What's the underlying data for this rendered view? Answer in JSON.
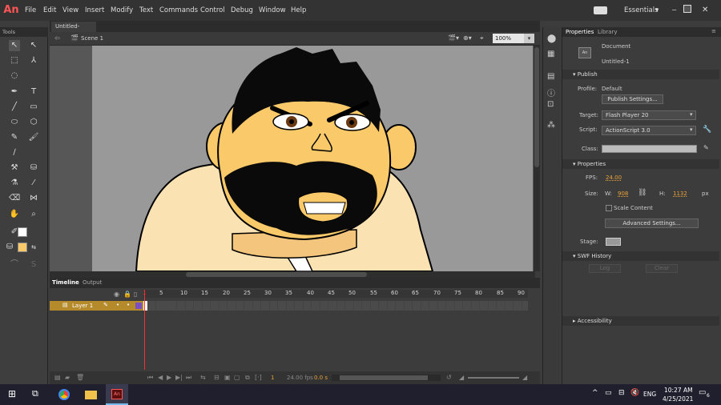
{
  "app": {
    "logo": "An",
    "workspace": "Essentials"
  },
  "menu": [
    "File",
    "Edit",
    "View",
    "Insert",
    "Modify",
    "Text",
    "Commands",
    "Control",
    "Debug",
    "Window",
    "Help"
  ],
  "tools_panel": {
    "title": "Tools"
  },
  "document": {
    "tab": "Untitled-1*",
    "scene": "Scene 1",
    "zoom": "100%"
  },
  "timeline": {
    "tabs": [
      "Timeline",
      "Output"
    ],
    "layer": "Layer 1",
    "frame_numbers": [
      "1",
      "5",
      "10",
      "15",
      "20",
      "25",
      "30",
      "35",
      "40",
      "45",
      "50",
      "55",
      "60",
      "65",
      "70",
      "75",
      "80",
      "85",
      "90"
    ],
    "current_frame": "1",
    "fps": "24.00 fps",
    "time": "0.0 s"
  },
  "properties": {
    "tabs": [
      "Properties",
      "Library"
    ],
    "doc_type": "Document",
    "doc_name": "Untitled-1",
    "publish": {
      "header": "Publish",
      "profile_label": "Profile:",
      "profile": "Default",
      "settings_btn": "Publish Settings...",
      "target_label": "Target:",
      "target": "Flash Player 20",
      "script_label": "Script:",
      "script": "ActionScript 3.0",
      "class_label": "Class:"
    },
    "props": {
      "header": "Properties",
      "fps_label": "FPS:",
      "fps": "24.00",
      "size_label": "Size:",
      "w_label": "W:",
      "w": "908",
      "h_label": "H:",
      "h": "1132",
      "unit": "px",
      "scale_label": "Scale Content",
      "advanced_btn": "Advanced Settings...",
      "stage_label": "Stage:",
      "stage_color": "#999999"
    },
    "swf": {
      "header": "SWF History",
      "log_btn": "Log",
      "clear_btn": "Clear"
    },
    "accessibility": {
      "header": "Accessibility"
    }
  },
  "taskbar": {
    "lang": "ENG",
    "time": "10:27 AM",
    "date": "4/25/2021",
    "notification_count": "6"
  }
}
